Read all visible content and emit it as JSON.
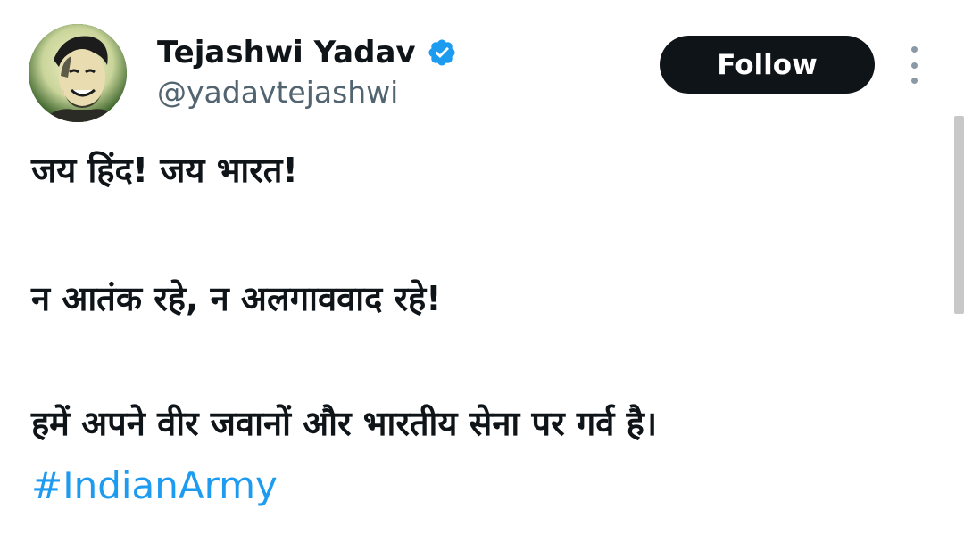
{
  "author": {
    "display_name": "Tejashwi Yadav",
    "handle": "@yadavtejashwi",
    "verified": true,
    "avatar_icon": "profile-photo"
  },
  "actions": {
    "follow_label": "Follow",
    "more_icon": "vertical-ellipsis-icon"
  },
  "tweet": {
    "lines": [
      "जय हिंद! जय भारत!",
      "न आतंक रहे, न अलगाववाद रहे!",
      "हमें अपने वीर जवानों और भारतीय सेना पर गर्व है।"
    ],
    "hashtag": "#IndianArmy"
  },
  "colors": {
    "text_primary": "#0f1419",
    "text_secondary": "#536471",
    "link": "#1d9bf0",
    "verified_badge": "#1d9bf0",
    "follow_button_bg": "#0f1419",
    "follow_button_text": "#ffffff"
  }
}
